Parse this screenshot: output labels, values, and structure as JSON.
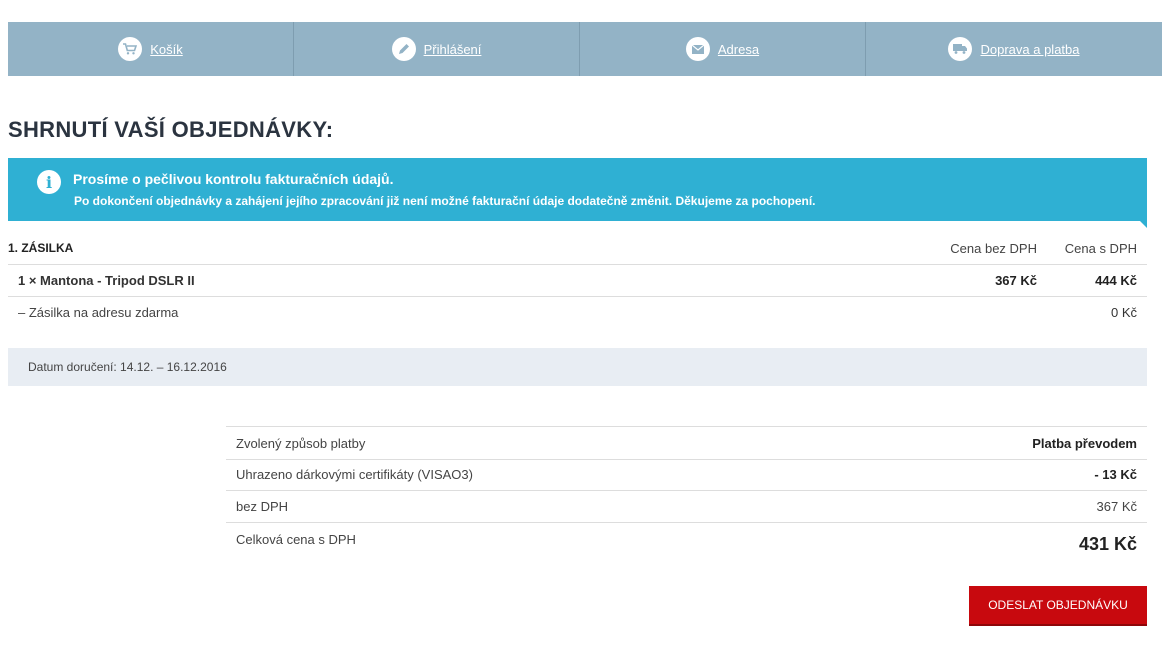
{
  "steps": [
    {
      "label": "Košík",
      "icon": "cart-icon"
    },
    {
      "label": "Přihlášení",
      "icon": "pencil-icon"
    },
    {
      "label": "Adresa",
      "icon": "envelope-icon"
    },
    {
      "label": "Doprava a platba",
      "icon": "truck-icon"
    }
  ],
  "page_title": "SHRNUTÍ VAŠÍ OBJEDNÁVKY:",
  "notice": {
    "title": "Prosíme o pečlivou kontrolu fakturačních údajů.",
    "text": "Po dokončení objednávky a zahájení jejího zpracování již není možné fakturační údaje dodatečně změnit. Děkujeme za pochopení."
  },
  "shipment": {
    "title": "1. ZÁSILKA",
    "col_without_vat": "Cena bez DPH",
    "col_with_vat": "Cena s DPH",
    "items": [
      {
        "name": "1 × Mantona - Tripod DSLR II",
        "price_without_vat": "367 Kč",
        "price_with_vat": "444 Kč"
      }
    ],
    "shipping": {
      "name": "– Zásilka na adresu zdarma",
      "price": "0 Kč"
    },
    "delivery": "Datum doručení: 14.12. – 16.12.2016"
  },
  "summary": {
    "payment_label": "Zvolený způsob platby",
    "payment_value": "Platba převodem",
    "voucher_label": "Uhrazeno dárkovými certifikáty (VISAO3)",
    "voucher_value": "- 13 Kč",
    "net_label": "bez DPH",
    "net_value": "367 Kč",
    "total_label": "Celková cena s DPH",
    "total_value": "431 Kč"
  },
  "submit_label": "ODESLAT OBJEDNÁVKU",
  "colors": {
    "steps_bg": "#93b3c6",
    "notice_bg": "#2fb0d3",
    "submit_bg": "#c8090e"
  }
}
